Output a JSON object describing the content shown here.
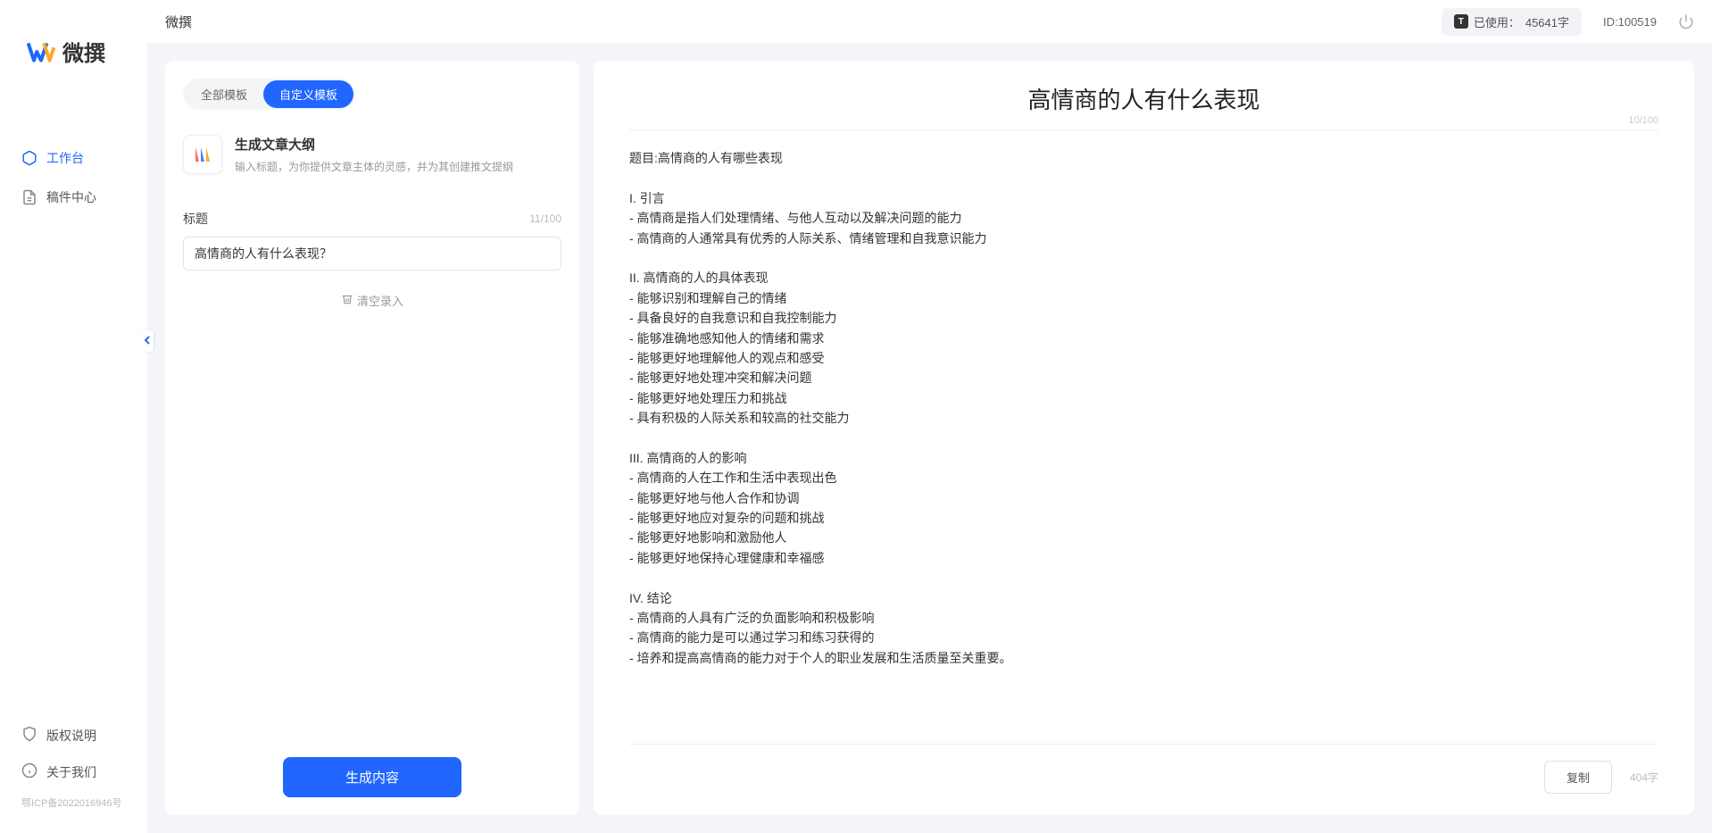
{
  "app": {
    "name": "微撰",
    "logo_text": "微撰"
  },
  "sidebar": {
    "nav": [
      {
        "label": "工作台",
        "icon": "cube-icon",
        "active": true
      },
      {
        "label": "稿件中心",
        "icon": "document-icon",
        "active": false
      }
    ],
    "footer": [
      {
        "label": "版权说明",
        "icon": "shield-icon"
      },
      {
        "label": "关于我们",
        "icon": "info-icon"
      }
    ],
    "icp": "鄂ICP备2022016946号"
  },
  "topbar": {
    "title": "微撰",
    "usage_prefix": "已使用：",
    "usage_value": "45641字",
    "user_id": "ID:100519"
  },
  "left_panel": {
    "tabs": [
      {
        "label": "全部模板",
        "active": false
      },
      {
        "label": "自定义模板",
        "active": true
      }
    ],
    "template": {
      "name": "生成文章大纲",
      "desc": "输入标题，为你提供文章主体的灵感，并为其创建推文提纲"
    },
    "field": {
      "label": "标题",
      "counter": "11/100",
      "value": "高情商的人有什么表现？"
    },
    "clear_label": "清空录入",
    "generate_label": "生成内容"
  },
  "right_panel": {
    "title": "高情商的人有什么表现",
    "title_counter": "10/100",
    "body": "题目:高情商的人有哪些表现\n\nI. 引言\n- 高情商是指人们处理情绪、与他人互动以及解决问题的能力\n- 高情商的人通常具有优秀的人际关系、情绪管理和自我意识能力\n\nII. 高情商的人的具体表现\n- 能够识别和理解自己的情绪\n- 具备良好的自我意识和自我控制能力\n- 能够准确地感知他人的情绪和需求\n- 能够更好地理解他人的观点和感受\n- 能够更好地处理冲突和解决问题\n- 能够更好地处理压力和挑战\n- 具有积极的人际关系和较高的社交能力\n\nIII. 高情商的人的影响\n- 高情商的人在工作和生活中表现出色\n- 能够更好地与他人合作和协调\n- 能够更好地应对复杂的问题和挑战\n- 能够更好地影响和激励他人\n- 能够更好地保持心理健康和幸福感\n\nIV. 结论\n- 高情商的人具有广泛的负面影响和积极影响\n- 高情商的能力是可以通过学习和练习获得的\n- 培养和提高高情商的能力对于个人的职业发展和生活质量至关重要。",
    "copy_label": "复制",
    "word_count": "404字"
  }
}
